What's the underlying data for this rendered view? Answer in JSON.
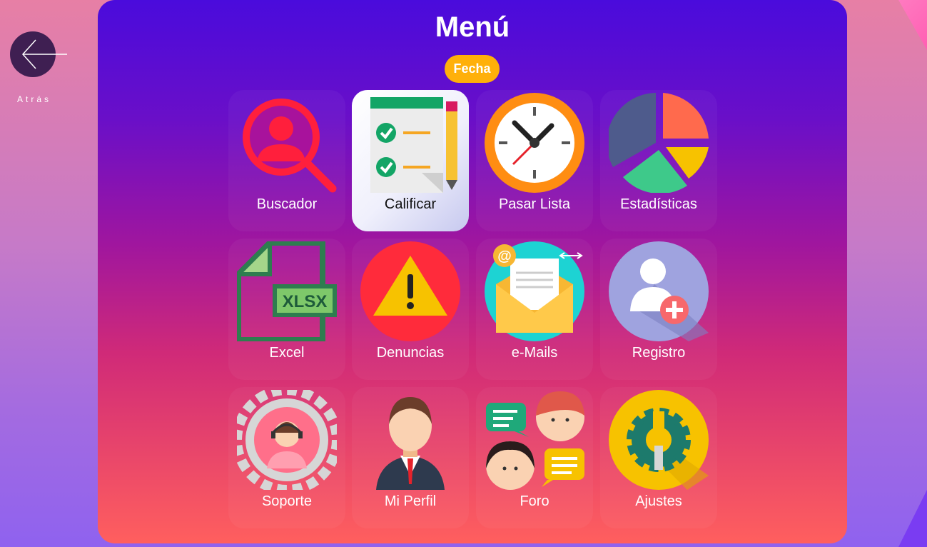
{
  "nav": {
    "back_label": "Atrás"
  },
  "header": {
    "title": "Menú",
    "date_label": "Fecha"
  },
  "menu": [
    {
      "label": "Buscador",
      "icon": "search-person-icon"
    },
    {
      "label": "Calificar",
      "icon": "checklist-icon",
      "selected": true
    },
    {
      "label": "Pasar Lista",
      "icon": "clock-icon"
    },
    {
      "label": "Estadísticas",
      "icon": "pie-chart-icon"
    },
    {
      "label": "Excel",
      "icon": "xlsx-file-icon"
    },
    {
      "label": "Denuncias",
      "icon": "warning-icon"
    },
    {
      "label": "e-Mails",
      "icon": "email-icon"
    },
    {
      "label": "Registro",
      "icon": "add-user-icon"
    },
    {
      "label": "Soporte",
      "icon": "support-gear-icon"
    },
    {
      "label": "Mi Perfil",
      "icon": "profile-icon"
    },
    {
      "label": "Foro",
      "icon": "forum-chat-icon"
    },
    {
      "label": "Ajustes",
      "icon": "settings-icon"
    }
  ],
  "colors": {
    "accent": "#ffb00a",
    "panel_top": "#4a0bdc",
    "panel_bottom": "#ff5f5e",
    "back_button": "#3f1f52"
  }
}
